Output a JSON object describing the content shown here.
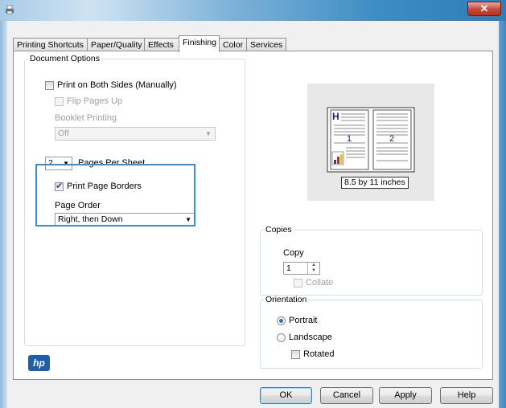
{
  "tabs": [
    "Printing Shortcuts",
    "Paper/Quality",
    "Effects",
    "Finishing",
    "Color",
    "Services"
  ],
  "active_tab": "Finishing",
  "document_options": {
    "legend": "Document Options",
    "print_both_sides": "Print on Both Sides (Manually)",
    "flip_pages_up": "Flip Pages Up",
    "booklet_label": "Booklet Printing",
    "booklet_value": "Off",
    "pages_per_sheet_value": "2",
    "pages_per_sheet_label": "Pages Per Sheet",
    "print_page_borders": "Print Page Borders",
    "page_order_label": "Page Order",
    "page_order_value": "Right, then Down"
  },
  "preview": {
    "page1": "1",
    "page2": "2",
    "paper_size": "8.5 by 11 inches"
  },
  "copies": {
    "legend": "Copies",
    "copy_label": "Copy",
    "copy_value": "1",
    "collate": "Collate"
  },
  "orientation": {
    "legend": "Orientation",
    "portrait": "Portrait",
    "landscape": "Landscape",
    "rotated": "Rotated"
  },
  "logo": "hp",
  "buttons": {
    "ok": "OK",
    "cancel": "Cancel",
    "apply": "Apply",
    "help": "Help"
  },
  "icons": {
    "close": "close-icon",
    "app": "printer-icon"
  }
}
